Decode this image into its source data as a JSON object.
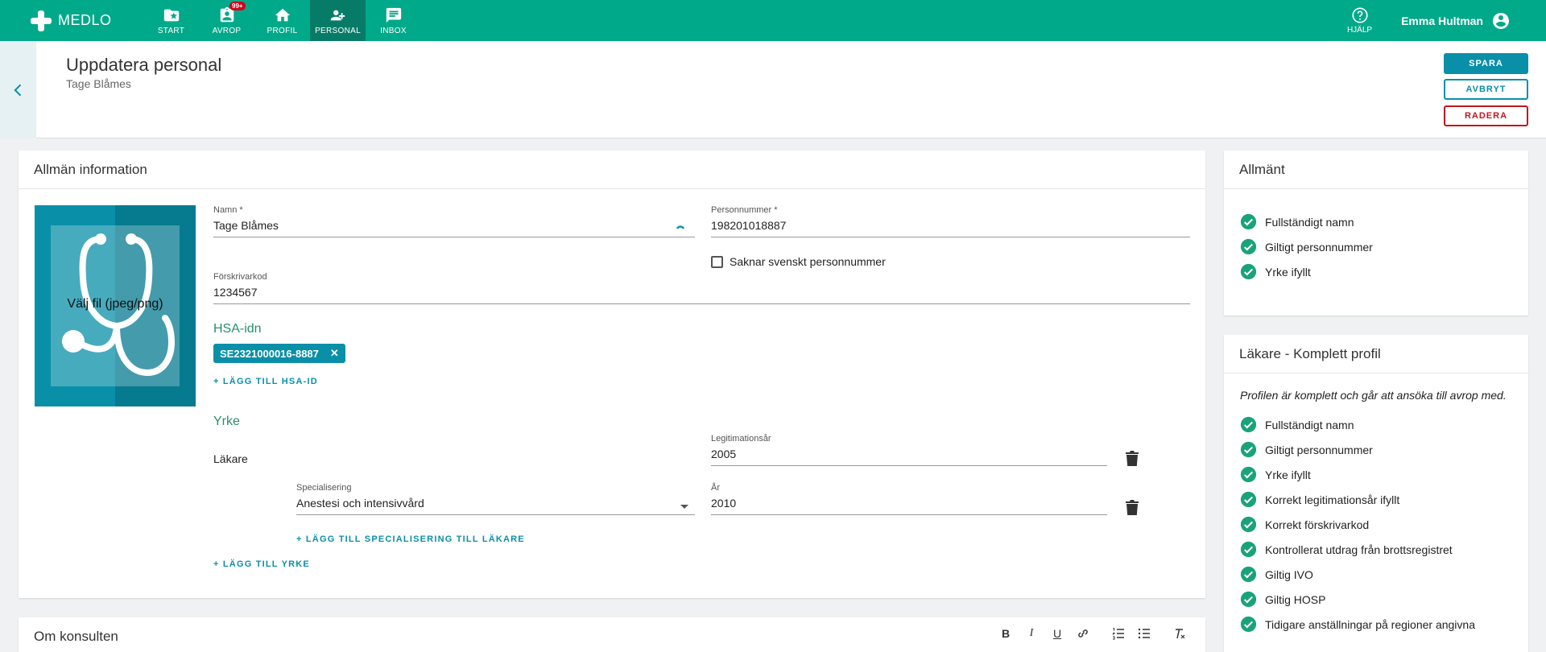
{
  "app": {
    "name": "MEDLO"
  },
  "nav": [
    {
      "label": "START",
      "icon": "folder-star-icon"
    },
    {
      "label": "AVROP",
      "icon": "assignment-icon",
      "badge": "99+"
    },
    {
      "label": "PROFIL",
      "icon": "home-icon"
    },
    {
      "label": "PERSONAL",
      "icon": "people-icon",
      "active": true
    },
    {
      "label": "INBOX",
      "icon": "chat-icon"
    }
  ],
  "topright": {
    "help_label": "HJÄLP",
    "user_name": "Emma Hultman"
  },
  "header": {
    "title": "Uppdatera personal",
    "subtitle": "Tage Blåmes",
    "save_label": "SPARA",
    "cancel_label": "AVBRYT",
    "delete_label": "RADERA"
  },
  "general": {
    "card_title": "Allmän information",
    "photo_label": "Välj fil (jpeg/png)",
    "name_label": "Namn *",
    "name_value": "Tage Blåmes",
    "pnr_label": "Personnummer *",
    "pnr_value": "198201018887",
    "no_pnr_label": "Saknar svenskt personnummer",
    "prescriber_label": "Förskrivarkod",
    "prescriber_value": "1234567",
    "hsa_heading": "HSA-idn",
    "hsa_chip": "SE2321000016-8887",
    "add_hsa": "+ LÄGG TILL HSA-ID",
    "yrke_heading": "Yrke",
    "yrke_value": "Läkare",
    "legyear_label": "Legitimationsår",
    "legyear_value": "2005",
    "spec_label": "Specialisering",
    "spec_value": "Anestesi och intensivvård",
    "year_label": "År",
    "year_value": "2010",
    "add_spec": "+ LÄGG TILL SPECIALISERING TILL LÄKARE",
    "add_yrke": "+ LÄGG TILL YRKE"
  },
  "about": {
    "card_title": "Om konsulten",
    "toolbar": [
      "B",
      "I",
      "U",
      "link",
      "ol",
      "ul",
      "clear"
    ]
  },
  "side_general": {
    "title": "Allmänt",
    "items": [
      "Fullständigt namn",
      "Giltigt personnummer",
      "Yrke ifyllt"
    ]
  },
  "side_profile": {
    "title": "Läkare - Komplett profil",
    "description": "Profilen är komplett och går att ansöka till avrop med.",
    "items": [
      "Fullständigt namn",
      "Giltigt personnummer",
      "Yrke ifyllt",
      "Korrekt legitimationsår ifyllt",
      "Korrekt förskrivarkod",
      "Kontrollerat utdrag från brottsregistret",
      "Giltig IVO",
      "Giltig HOSP",
      "Tidigare anställningar på regioner angivna"
    ]
  },
  "colors": {
    "brand": "#00a98a",
    "accent": "#0a8fa8",
    "danger": "#c4161c",
    "check": "#1aa37a"
  }
}
